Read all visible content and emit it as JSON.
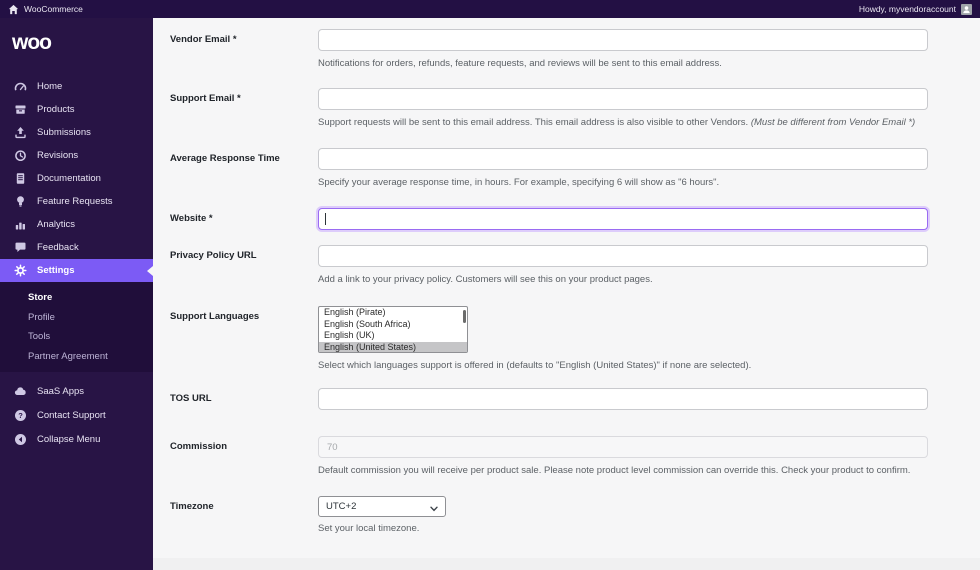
{
  "admin_bar": {
    "site_name": "WooCommerce",
    "howdy": "Howdy, myvendoraccount"
  },
  "sidebar": {
    "logo_text": "woo",
    "menu": [
      {
        "label": "Home",
        "icon": "dashboard-icon"
      },
      {
        "label": "Products",
        "icon": "products-icon"
      },
      {
        "label": "Submissions",
        "icon": "upload-icon"
      },
      {
        "label": "Revisions",
        "icon": "history-icon"
      },
      {
        "label": "Documentation",
        "icon": "document-icon"
      },
      {
        "label": "Feature Requests",
        "icon": "lightbulb-icon"
      },
      {
        "label": "Analytics",
        "icon": "bar-chart-icon"
      },
      {
        "label": "Feedback",
        "icon": "chat-icon"
      },
      {
        "label": "Settings",
        "icon": "gear-icon",
        "active": true
      }
    ],
    "submenu": [
      {
        "label": "Store",
        "active": true
      },
      {
        "label": "Profile"
      },
      {
        "label": "Tools"
      },
      {
        "label": "Partner Agreement"
      }
    ],
    "footer_menu": [
      {
        "label": "SaaS Apps",
        "icon": "cloud-icon"
      },
      {
        "label": "Contact Support",
        "icon": "help-icon"
      },
      {
        "label": "Collapse Menu",
        "icon": "collapse-icon"
      }
    ]
  },
  "form": {
    "fields": [
      {
        "label": "Vendor Email *",
        "value": "",
        "desc": "Notifications for orders, refunds, feature requests, and reviews will be sent to this email address."
      },
      {
        "label": "Support Email *",
        "value": "",
        "desc": "Support requests will be sent to this email address. This email address is also visible to other Vendors. ",
        "desc_em": "(Must be different from Vendor Email *)"
      },
      {
        "label": "Average Response Time",
        "value": "",
        "desc": "Specify your average response time, in hours. For example, specifying 6 will show as \"6 hours\"."
      },
      {
        "label": "Website *",
        "value": "",
        "focused": true
      },
      {
        "label": "Privacy Policy URL",
        "value": "",
        "desc": "Add a link to your privacy policy. Customers will see this on your product pages."
      },
      {
        "label": "Support Languages",
        "options": [
          "English (Pirate)",
          "English (South Africa)",
          "English (UK)",
          "English (United States)"
        ],
        "selected": "English (United States)",
        "desc": "Select which languages support is offered in (defaults to \"English (United States)\" if none are selected)."
      },
      {
        "label": "TOS URL",
        "value": ""
      },
      {
        "label": "Commission",
        "value": "70",
        "disabled": true,
        "desc": "Default commission you will receive per product sale. Please note product level commission can override this. Check your product to confirm."
      },
      {
        "label": "Timezone",
        "value": "UTC+2",
        "desc": "Set your local timezone."
      }
    ]
  },
  "colors": {
    "accent_purple": "#7c5bf5",
    "sidebar_bg": "#281445",
    "admin_bar_bg": "#231044",
    "focus_border": "#9a6bf2",
    "content_bg": "#f6f6f7"
  }
}
